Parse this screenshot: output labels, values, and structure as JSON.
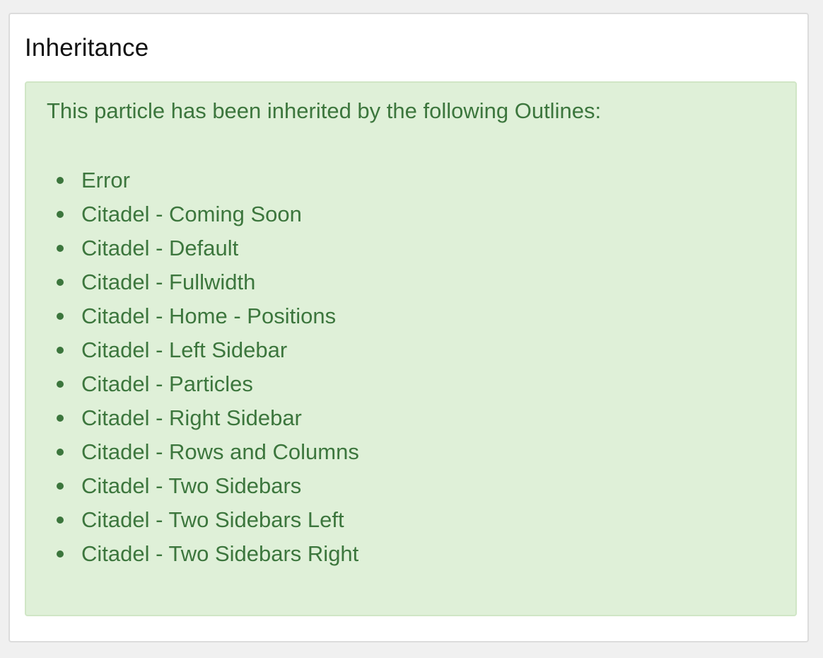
{
  "card": {
    "title": "Inheritance"
  },
  "alert": {
    "message": "This particle has been inherited by the following Outlines:",
    "outlines": [
      "Error",
      "Citadel - Coming Soon",
      "Citadel - Default",
      "Citadel - Fullwidth",
      "Citadel - Home - Positions",
      "Citadel - Left Sidebar",
      "Citadel - Particles",
      "Citadel - Right Sidebar",
      "Citadel - Rows and Columns",
      "Citadel - Two Sidebars",
      "Citadel - Two Sidebars Left",
      "Citadel - Two Sidebars Right"
    ]
  },
  "colors": {
    "alert_background": "#dff0d8",
    "alert_text": "#3c763d",
    "page_background": "#f0f0f0"
  }
}
